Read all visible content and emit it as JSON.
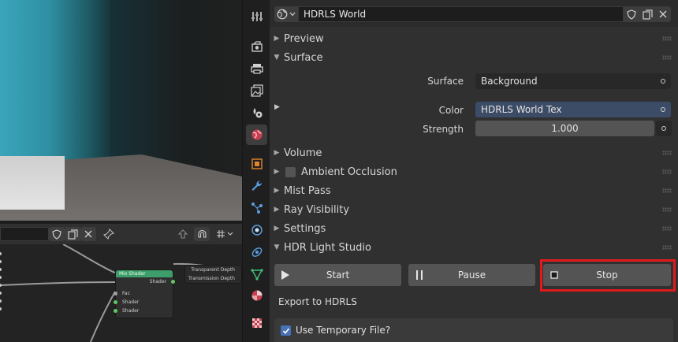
{
  "header": {
    "world_name": "HDRLS World"
  },
  "sections": {
    "preview": "Preview",
    "surface": "Surface",
    "volume": "Volume",
    "ambient_occlusion": "Ambient Occlusion",
    "mist_pass": "Mist Pass",
    "ray_visibility": "Ray Visibility",
    "settings": "Settings",
    "hdr_light_studio": "HDR Light Studio"
  },
  "surface": {
    "surface_label": "Surface",
    "surface_value": "Background",
    "color_label": "Color",
    "color_value": "HDRLS World Tex",
    "strength_label": "Strength",
    "strength_value": "1.000"
  },
  "hdrls": {
    "start_label": "Start",
    "pause_label": "Pause",
    "stop_label": "Stop",
    "export_label": "Export to HDRLS",
    "use_temp_label": "Use Temporary File?",
    "use_temp_checked": true
  },
  "node_editor": {
    "mix_shader_title": "Mix Shader",
    "mix_output": "Shader",
    "mix_inputs": [
      "Fac",
      "Shader",
      "Shader"
    ],
    "output_node_rows": [
      "Transparent Depth",
      "Transmission Depth"
    ]
  },
  "colors": {
    "accent_blue": "#4772b3",
    "highlight_red": "#e01a1a",
    "node_green": "#3d9e6b",
    "panel_bg": "#303030"
  },
  "icons": {
    "tabs": [
      "tool-icon",
      "render-icon",
      "output-icon",
      "view-layer-icon",
      "scene-icon",
      "world-icon",
      "object-icon",
      "modifier-icon",
      "particles-icon",
      "physics-icon",
      "constraints-icon",
      "data-icon",
      "material-icon",
      "texture-icon"
    ]
  }
}
